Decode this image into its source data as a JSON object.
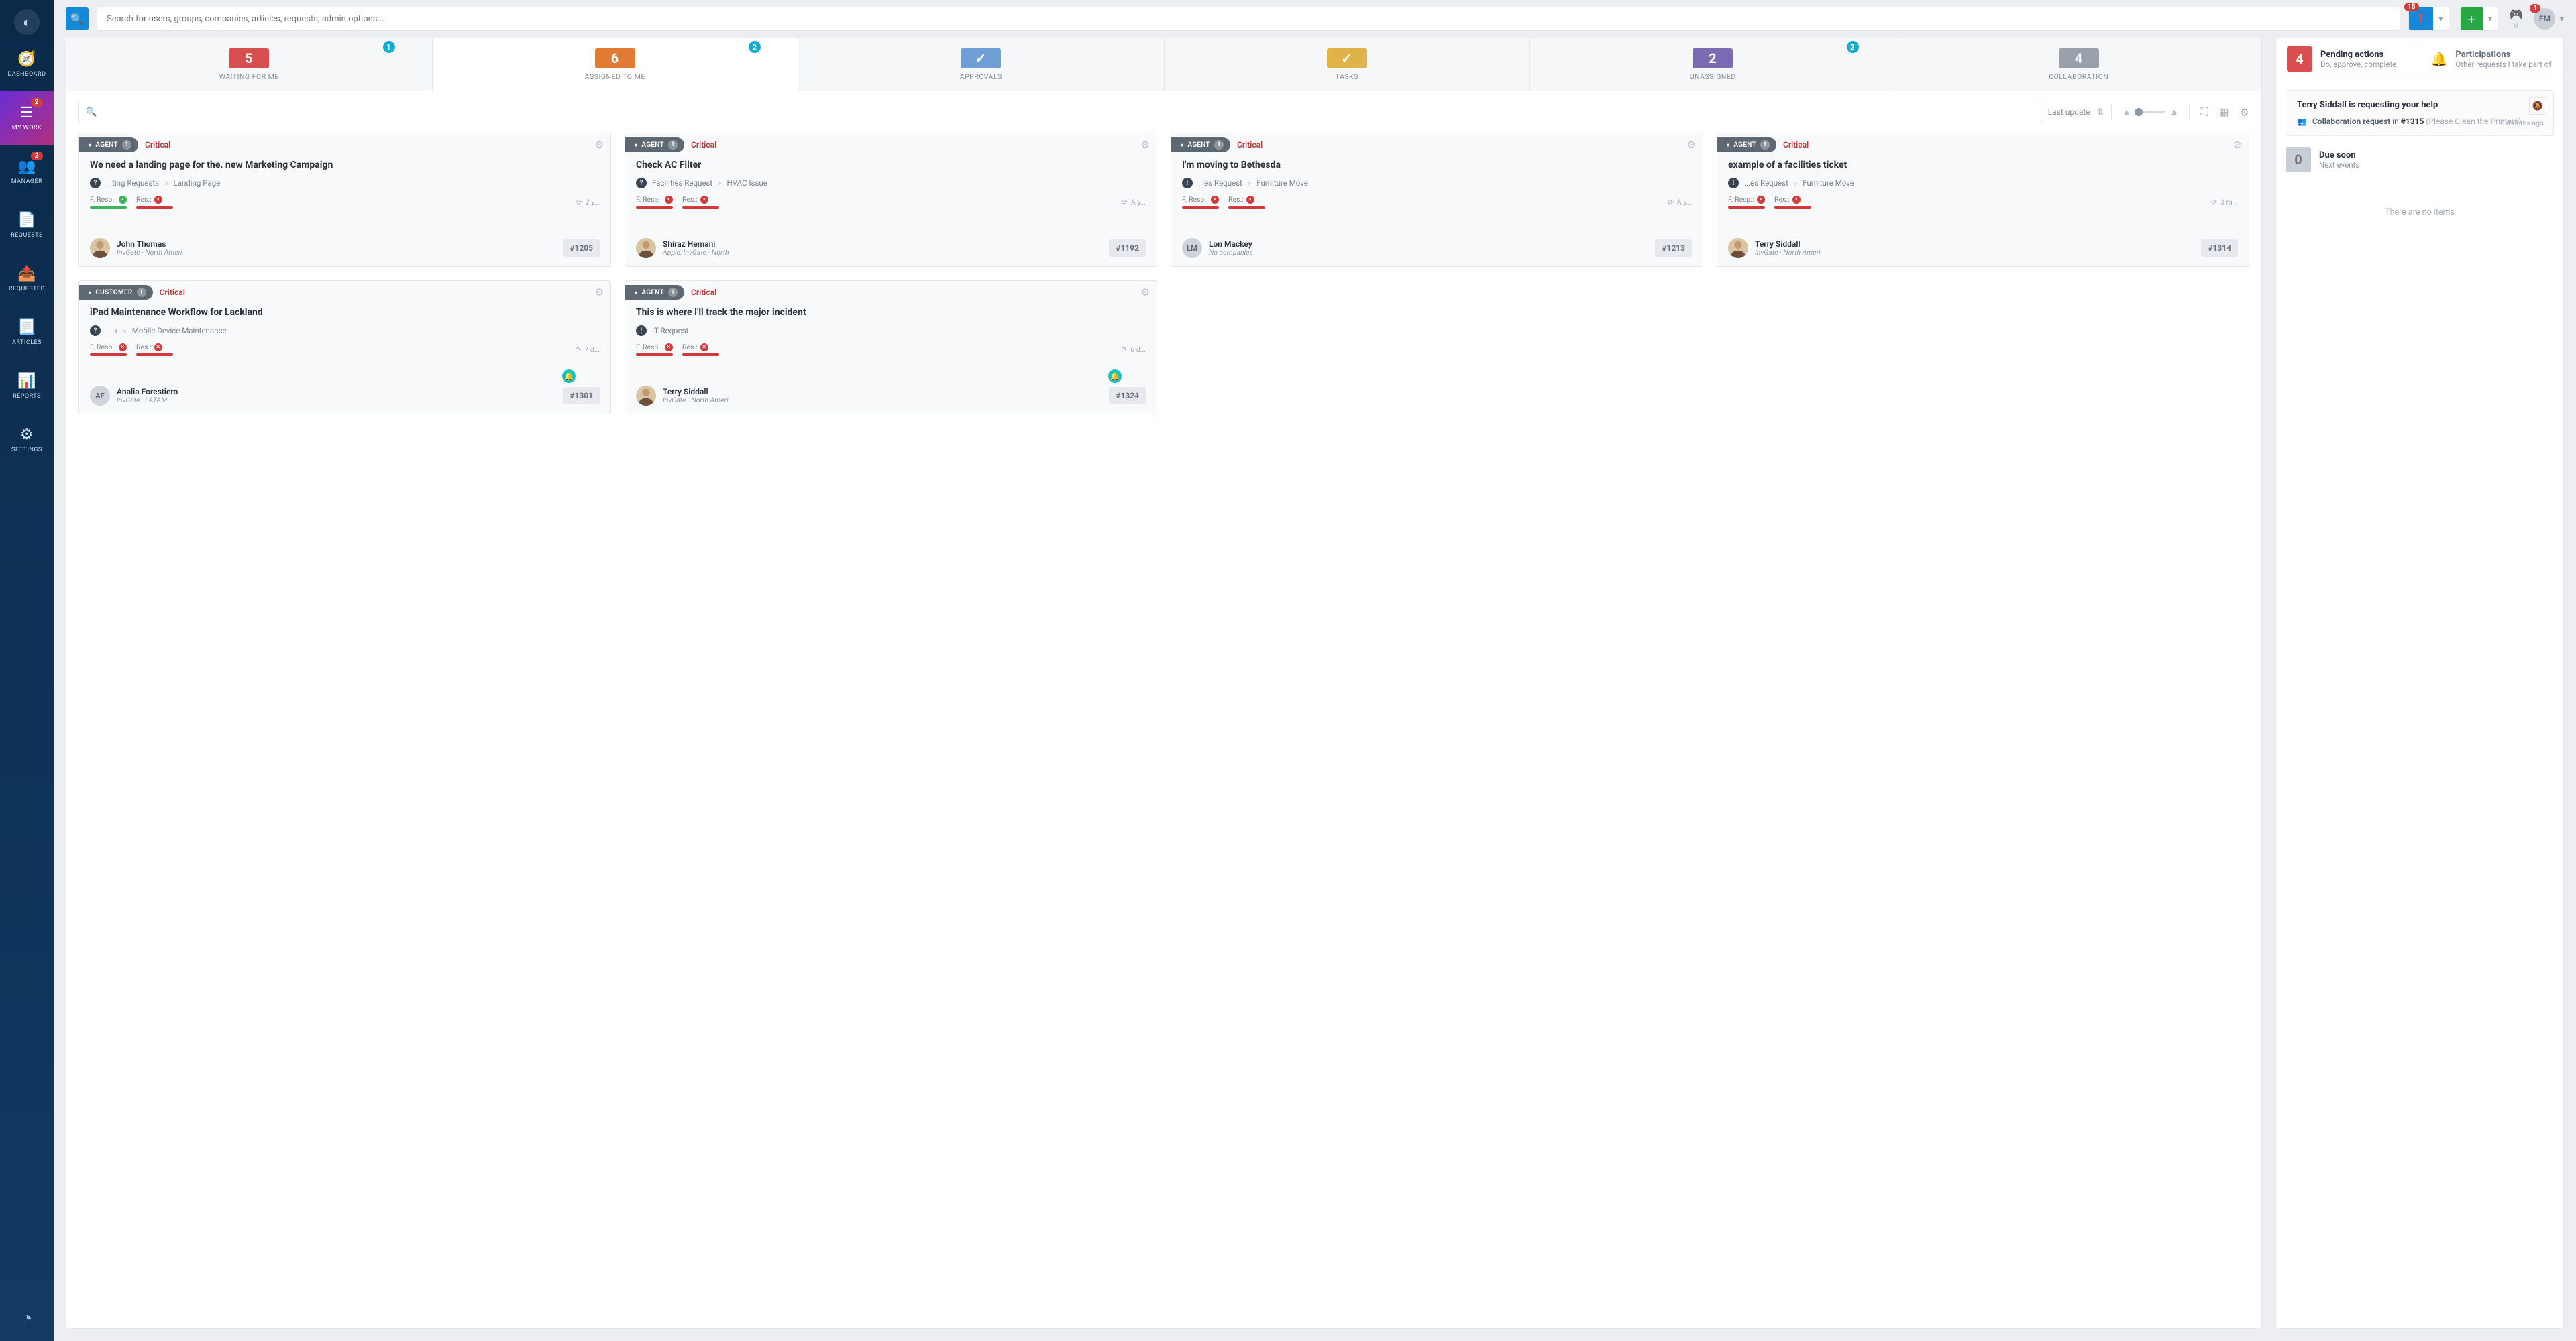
{
  "sidebar": {
    "items": [
      {
        "label": "DASHBOARD"
      },
      {
        "label": "MY WORK",
        "badge": "2"
      },
      {
        "label": "MANAGER",
        "badge": "2"
      },
      {
        "label": "REQUESTS"
      },
      {
        "label": "REQUESTED"
      },
      {
        "label": "ARTICLES"
      },
      {
        "label": "REPORTS"
      },
      {
        "label": "SETTINGS"
      }
    ]
  },
  "topbar": {
    "search_placeholder": "Search for users, groups, companies, articles, requests, admin options...",
    "notif_icon_count": "15",
    "gamepad_count": "0",
    "avatar_initials": "FM",
    "avatar_badge": "1"
  },
  "tabs": [
    {
      "count": "5",
      "label": "WAITING FOR ME",
      "badge": "1"
    },
    {
      "count": "6",
      "label": "ASSIGNED TO ME",
      "badge": "2"
    },
    {
      "count": "",
      "label": "APPROVALS"
    },
    {
      "count": "",
      "label": "TASKS"
    },
    {
      "count": "2",
      "label": "UNASSIGNED",
      "badge": "2"
    },
    {
      "count": "4",
      "label": "COLLABORATION"
    }
  ],
  "filter": {
    "sort_label": "Last update"
  },
  "cards": [
    {
      "role": "AGENT",
      "role_count": "1",
      "priority": "Critical",
      "title": "We need a landing page for the. new Marketing Campaign",
      "path_a": "...ting Requests",
      "path_b": "Landing Page",
      "path_icon": "?",
      "fresp_status": "ok",
      "res_status": "bad",
      "age_text": "2 y...",
      "user_name": "John Thomas",
      "user_org": "InvGate · North Ameri",
      "user_initials": "",
      "user_photo": true,
      "ticket": "#1205",
      "has_bell": false
    },
    {
      "role": "AGENT",
      "role_count": "1",
      "priority": "Critical",
      "title": "Check AC Filter",
      "path_a": "Facilities Request",
      "path_b": "HVAC Issue",
      "path_icon": "?",
      "fresp_status": "bad",
      "res_status": "bad",
      "age_text": "A y...",
      "user_name": "Shiraz Hemani",
      "user_org": "Apple, InvGate · North",
      "user_initials": "",
      "user_photo": true,
      "ticket": "#1192",
      "has_bell": false
    },
    {
      "role": "AGENT",
      "role_count": "1",
      "priority": "Critical",
      "title": "I'm moving to Bethesda",
      "path_a": "...es Request",
      "path_b": "Furniture Move",
      "path_icon": "!",
      "fresp_status": "bad",
      "res_status": "bad",
      "age_text": "A y...",
      "user_name": "Lon Mackey",
      "user_org": "No companies",
      "user_initials": "LM",
      "user_photo": false,
      "ticket": "#1213",
      "has_bell": false
    },
    {
      "role": "AGENT",
      "role_count": "1",
      "priority": "Critical",
      "title": "example of a facilities ticket",
      "path_a": "...es Request",
      "path_b": "Furniture Move",
      "path_icon": "!",
      "fresp_status": "bad",
      "res_status": "bad",
      "age_text": "3 m...",
      "user_name": "Terry Siddall",
      "user_org": "InvGate · North Ameri",
      "user_initials": "",
      "user_photo": true,
      "ticket": "#1314",
      "has_bell": false
    },
    {
      "role": "CUSTOMER",
      "role_count": "1",
      "priority": "Critical",
      "title": "iPad Maintenance Workflow for Lackland",
      "path_a": "... »",
      "path_b": "Mobile Device Maintenance",
      "path_icon": "?",
      "fresp_status": "bad",
      "res_status": "bad",
      "age_text": "7 d...",
      "user_name": "Analia Forestiero",
      "user_org": "InvGate · LATAM",
      "user_initials": "AF",
      "user_photo": false,
      "ticket": "#1301",
      "has_bell": true
    },
    {
      "role": "AGENT",
      "role_count": "1",
      "priority": "Critical",
      "title": "This is where I'll track the major incident",
      "path_a": "IT Request",
      "path_b": "",
      "path_icon": "!",
      "fresp_status": "bad",
      "res_status": "bad",
      "age_text": "6 d...",
      "user_name": "Terry Siddall",
      "user_org": "InvGate · North Ameri",
      "user_initials": "",
      "user_photo": true,
      "ticket": "#1324",
      "has_bell": true
    }
  ],
  "sla_labels": {
    "fresp": "F. Resp.:",
    "res": "Res.:"
  },
  "right": {
    "pending": {
      "count": "4",
      "title": "Pending actions",
      "subtitle": "Do, approve, complete"
    },
    "participations": {
      "title": "Participations",
      "subtitle": "Other requests I take part of"
    },
    "collab": {
      "header": "Terry Siddall is requesting your help",
      "prefix": "Collaboration request",
      "in_word": "in",
      "ticket": "#1315",
      "ticket_title": "(Please Clean the Printers)",
      "when": "8 months ago"
    },
    "due": {
      "count": "0",
      "title": "Due soon",
      "subtitle": "Next events"
    },
    "empty": "There are no items"
  }
}
